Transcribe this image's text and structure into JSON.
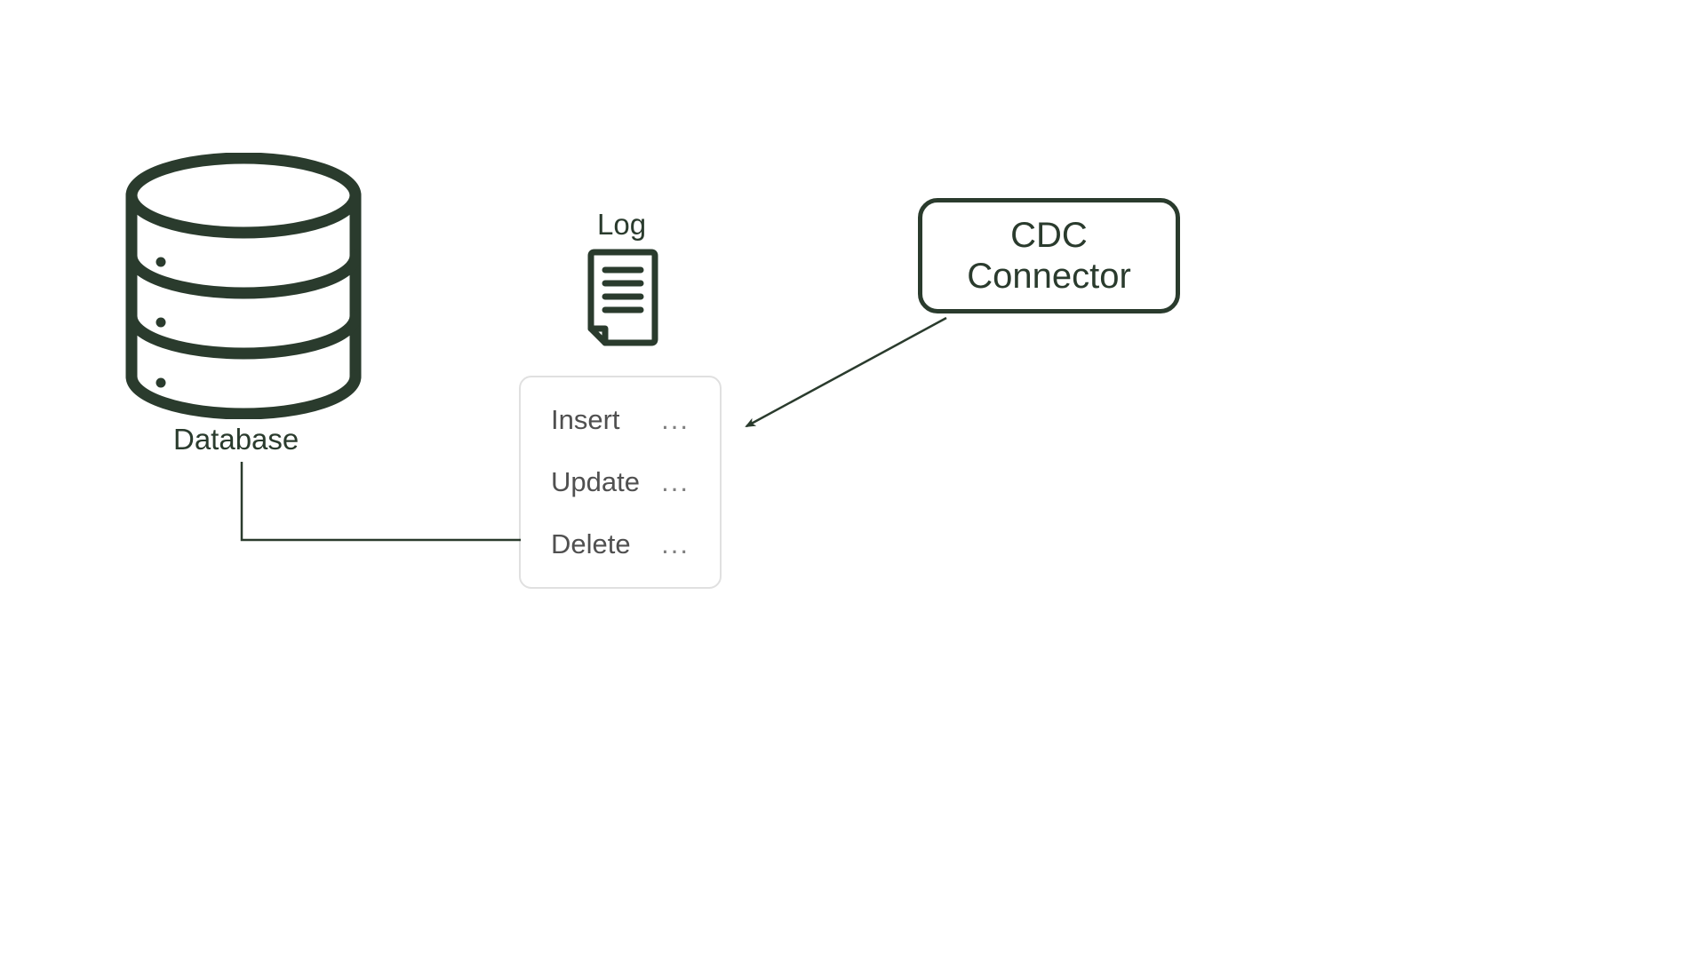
{
  "database": {
    "label": "Database"
  },
  "log": {
    "title": "Log",
    "entries": [
      {
        "op": "Insert",
        "detail": "..."
      },
      {
        "op": "Update",
        "detail": "..."
      },
      {
        "op": "Delete",
        "detail": "..."
      }
    ]
  },
  "cdc": {
    "label_line1": "CDC",
    "label_line2": "Connector"
  },
  "colors": {
    "stroke": "#2a3b2d",
    "box_border": "#e0e0e0",
    "text_muted": "#505050"
  }
}
